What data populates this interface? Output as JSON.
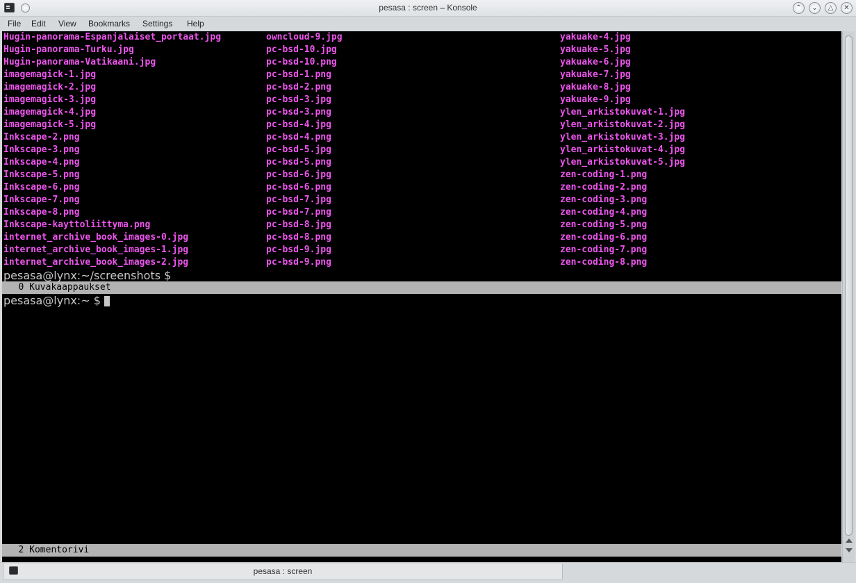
{
  "window": {
    "title": "pesasa : screen – Konsole"
  },
  "menu": [
    "File",
    "Edit",
    "View",
    "Bookmarks",
    "Settings",
    "Help"
  ],
  "terminal": {
    "file_rows": [
      [
        "Hugin-panorama-Espanjalaiset_portaat.jpg",
        "owncloud-9.jpg",
        "yakuake-4.jpg"
      ],
      [
        "Hugin-panorama-Turku.jpg",
        "pc-bsd-10.jpg",
        "yakuake-5.jpg"
      ],
      [
        "Hugin-panorama-Vatikaani.jpg",
        "pc-bsd-10.png",
        "yakuake-6.jpg"
      ],
      [
        "imagemagick-1.jpg",
        "pc-bsd-1.png",
        "yakuake-7.jpg"
      ],
      [
        "imagemagick-2.jpg",
        "pc-bsd-2.png",
        "yakuake-8.jpg"
      ],
      [
        "imagemagick-3.jpg",
        "pc-bsd-3.jpg",
        "yakuake-9.jpg"
      ],
      [
        "imagemagick-4.jpg",
        "pc-bsd-3.png",
        "ylen_arkistokuvat-1.jpg"
      ],
      [
        "imagemagick-5.jpg",
        "pc-bsd-4.jpg",
        "ylen_arkistokuvat-2.jpg"
      ],
      [
        "Inkscape-2.png",
        "pc-bsd-4.png",
        "ylen_arkistokuvat-3.jpg"
      ],
      [
        "Inkscape-3.png",
        "pc-bsd-5.jpg",
        "ylen_arkistokuvat-4.jpg"
      ],
      [
        "Inkscape-4.png",
        "pc-bsd-5.png",
        "ylen_arkistokuvat-5.jpg"
      ],
      [
        "Inkscape-5.png",
        "pc-bsd-6.jpg",
        "zen-coding-1.png"
      ],
      [
        "Inkscape-6.png",
        "pc-bsd-6.png",
        "zen-coding-2.png"
      ],
      [
        "Inkscape-7.png",
        "pc-bsd-7.jpg",
        "zen-coding-3.png"
      ],
      [
        "Inkscape-8.png",
        "pc-bsd-7.png",
        "zen-coding-4.png"
      ],
      [
        "Inkscape-kayttoliittyma.png",
        "pc-bsd-8.jpg",
        "zen-coding-5.png"
      ],
      [
        "internet_archive_book_images-0.jpg",
        "pc-bsd-8.png",
        "zen-coding-6.png"
      ],
      [
        "internet_archive_book_images-1.jpg",
        "pc-bsd-9.jpg",
        "zen-coding-7.png"
      ],
      [
        "internet_archive_book_images-2.jpg",
        "pc-bsd-9.png",
        "zen-coding-8.png"
      ]
    ],
    "prompt_screenshots": "pesasa@lynx:~/screenshots $",
    "screen_top_bar": "   0 Kuvakaappaukset",
    "prompt_home": "pesasa@lynx:~ $ ",
    "screen_bottom_bar": "   2 Komentorivi"
  },
  "tab": {
    "label": "pesasa : screen"
  },
  "colors": {
    "file_text": "#ee55ee",
    "terminal_bg": "#000000",
    "screen_bar_bg": "#b3b3b3"
  }
}
